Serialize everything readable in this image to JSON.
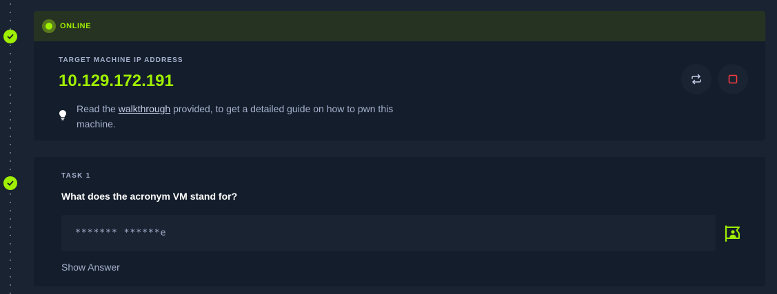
{
  "machine": {
    "status": "ONLINE",
    "ip_label": "TARGET MACHINE IP ADDRESS",
    "ip_address": "10.129.172.191",
    "tip_prefix": "Read the ",
    "tip_link": "walkthrough",
    "tip_suffix": " provided, to get a detailed guide on how to pwn this machine."
  },
  "task": {
    "label": "TASK 1",
    "question": "What does the acronym VM stand for?",
    "answer_mask": "******* ******e",
    "show_answer_label": "Show Answer"
  },
  "icons": [
    "check-icon",
    "reset-icon",
    "stop-icon",
    "lightbulb-icon",
    "hint-flag-icon"
  ],
  "colors": {
    "accent": "#9fef00",
    "background": "#1a2332",
    "card": "#141d2b",
    "status_bar": "#263322",
    "muted_text": "#a4b1cd",
    "stop_red": "#ff3e3e"
  }
}
